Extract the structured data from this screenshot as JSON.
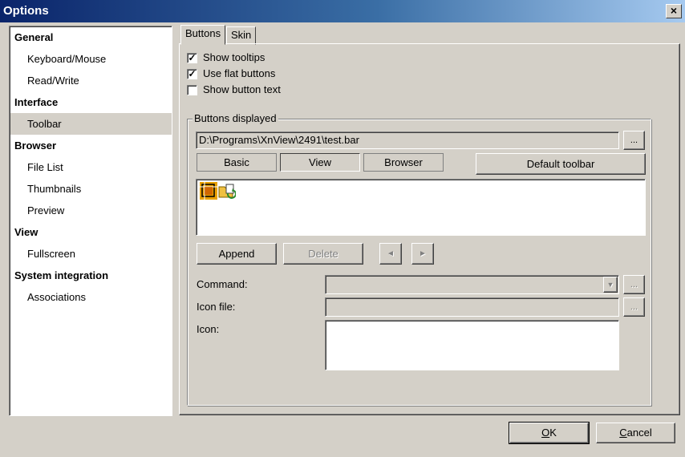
{
  "window": {
    "title": "Options",
    "close_glyph": "×"
  },
  "sidebar": {
    "items": [
      {
        "label": "General",
        "kind": "category"
      },
      {
        "label": "Keyboard/Mouse",
        "kind": "item"
      },
      {
        "label": "Read/Write",
        "kind": "item"
      },
      {
        "label": "Interface",
        "kind": "category"
      },
      {
        "label": "Toolbar",
        "kind": "item",
        "selected": true
      },
      {
        "label": "Browser",
        "kind": "category"
      },
      {
        "label": "File List",
        "kind": "item"
      },
      {
        "label": "Thumbnails",
        "kind": "item"
      },
      {
        "label": "Preview",
        "kind": "item"
      },
      {
        "label": "View",
        "kind": "category"
      },
      {
        "label": "Fullscreen",
        "kind": "item"
      },
      {
        "label": "System integration",
        "kind": "category"
      },
      {
        "label": "Associations",
        "kind": "item"
      }
    ]
  },
  "tabs": [
    {
      "label": "Buttons",
      "active": true
    },
    {
      "label": "Skin",
      "active": false
    }
  ],
  "options": {
    "show_tooltips": {
      "label": "Show tooltips",
      "checked": true
    },
    "use_flat_buttons": {
      "label": "Use flat buttons",
      "checked": true
    },
    "show_button_text": {
      "label": "Show button text",
      "checked": false
    }
  },
  "buttons_displayed": {
    "group_label": "Buttons displayed",
    "path_value": "D:\\Programs\\XnView\\2491\\test.bar",
    "browse_label": "...",
    "basic_label": "Basic",
    "view_label": "View",
    "browser_label": "Browser",
    "default_toolbar_label": "Default toolbar",
    "icons": [
      "crop-icon",
      "open-folder-icon"
    ],
    "append_label": "Append",
    "delete_label": "Delete",
    "prev_glyph": "◄",
    "next_glyph": "►",
    "command_label": "Command:",
    "command_value": "",
    "icon_file_label": "Icon file:",
    "icon_file_value": "",
    "icon_label": "Icon:",
    "dropdown_glyph": "▼"
  },
  "footer": {
    "ok_prefix": "",
    "ok_underlined": "O",
    "ok_rest": "K",
    "cancel_underlined": "C",
    "cancel_rest": "ancel"
  }
}
